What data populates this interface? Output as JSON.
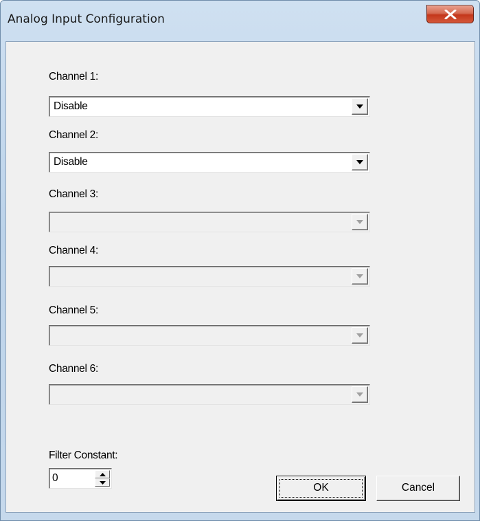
{
  "window": {
    "title": "Analog Input Configuration"
  },
  "channels": [
    {
      "label": "Channel 1:",
      "value": "Disable",
      "enabled": true
    },
    {
      "label": "Channel 2:",
      "value": "Disable",
      "enabled": true
    },
    {
      "label": "Channel 3:",
      "value": "",
      "enabled": false
    },
    {
      "label": "Channel 4:",
      "value": "",
      "enabled": false
    },
    {
      "label": "Channel 5:",
      "value": "",
      "enabled": false
    },
    {
      "label": "Channel 6:",
      "value": "",
      "enabled": false
    }
  ],
  "filter": {
    "label": "Filter Constant:",
    "value": "0"
  },
  "buttons": {
    "ok": "OK",
    "cancel": "Cancel"
  },
  "icons": {
    "close": "close-icon",
    "dropdown": "chevron-down-icon",
    "spin_up": "spin-up-icon",
    "spin_down": "spin-down-icon"
  }
}
